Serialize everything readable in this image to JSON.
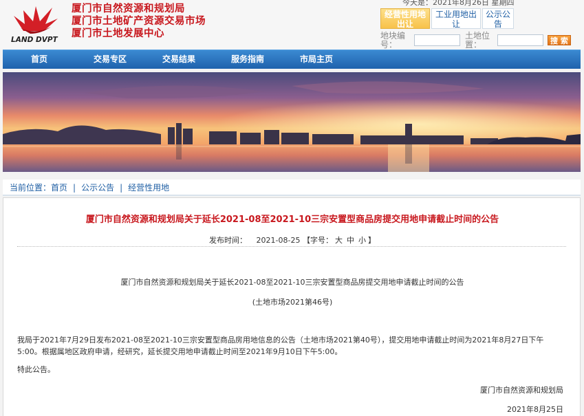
{
  "header": {
    "org_lines": [
      "厦门市自然资源和规划局",
      "厦门市土地矿产资源交易市场",
      "厦门市土地发展中心"
    ],
    "logo_text": "LAND DVPT",
    "date_line": "今天是：2021年8月26日  星期四",
    "type_tabs": [
      "经营性用地出让",
      "工业用地出让",
      "公示公告"
    ],
    "active_tab": 0,
    "search": {
      "plot_no_label": "地块编号：",
      "plot_no_value": "",
      "location_label": "土地位置：",
      "location_value": "",
      "button_label": "搜 索"
    }
  },
  "nav": {
    "items": [
      "首页",
      "交易专区",
      "交易结果",
      "服务指南",
      "市局主页"
    ]
  },
  "breadcrumb": {
    "label": "当前位置：",
    "items": [
      "首页",
      "公示公告",
      "经营性用地"
    ]
  },
  "article": {
    "title": "厦门市自然资源和规划局关于延长2021-08至2021-10三宗安置型商品房提交用地申请截止时间的公告",
    "publish_label": "发布时间：",
    "publish_date": "2021-08-25",
    "font_size_label_open": "【字号：",
    "font_size_options": [
      "大",
      "中",
      "小"
    ],
    "font_size_label_close": "】",
    "body_title": "厦门市自然资源和规划局关于延长2021-08至2021-10三宗安置型商品房提交用地申请截止时间的公告",
    "body_subtitle": "(土地市场2021第46号)",
    "paragraph_1": "我局于2021年7月29日发布2021-08至2021-10三宗安置型商品房用地信息的公告（土地市场2021第40号），提交用地申请截止时间为2021年8月27日下午5:00。根据属地区政府申请，经研究，延长提交用地申请截止时间至2021年9月10日下午5:00。",
    "paragraph_2": "特此公告。",
    "signature": "厦门市自然资源和规划局",
    "signature_date": "2021年8月25日"
  },
  "colors": {
    "brand_red": "#c8181e",
    "nav_blue": "#1f62ad",
    "link_blue": "#1f5fa4",
    "accent_orange": "#e2741b"
  }
}
